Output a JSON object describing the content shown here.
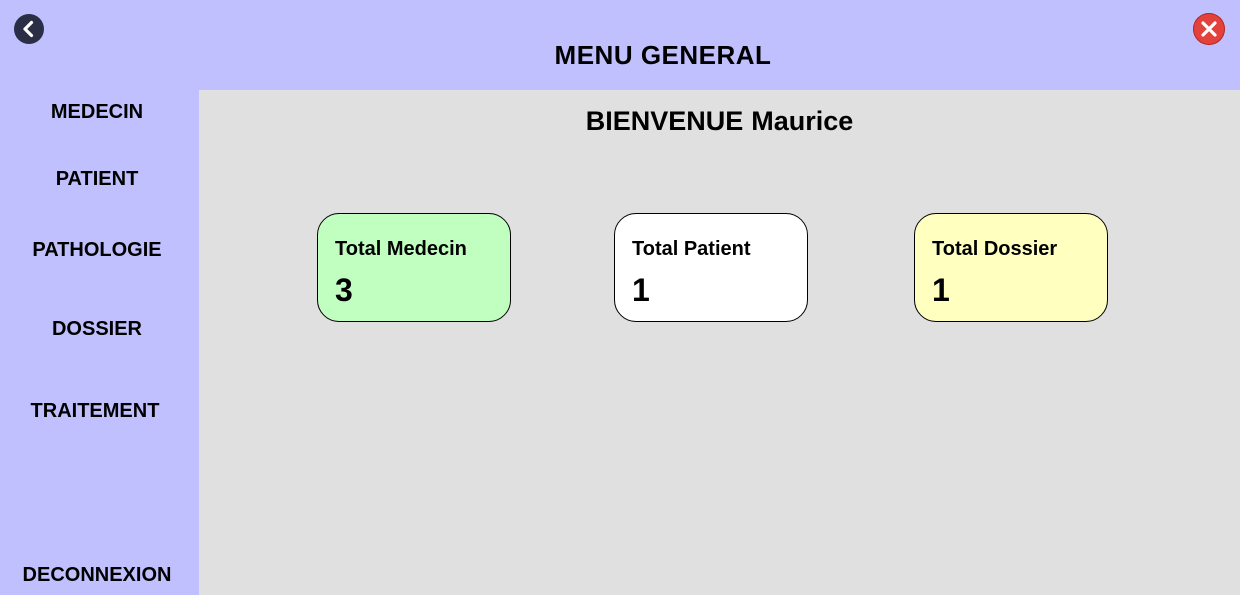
{
  "window": {
    "title": "MENU GENERAL",
    "back_icon": "back-arrow-icon",
    "close_icon": "close-icon"
  },
  "sidebar": {
    "items": [
      {
        "label": "MEDECIN"
      },
      {
        "label": "PATIENT"
      },
      {
        "label": "PATHOLOGIE"
      },
      {
        "label": "DOSSIER"
      },
      {
        "label": "TRAITEMENT"
      }
    ],
    "logout_label": "DECONNEXION"
  },
  "main": {
    "welcome_prefix": "BIENVENUE",
    "user_name": "Maurice",
    "cards": [
      {
        "label": "Total Medecin",
        "value": "3",
        "color": "#c0ffc0"
      },
      {
        "label": "Total Patient",
        "value": "1",
        "color": "#ffffff"
      },
      {
        "label": "Total Dossier",
        "value": "1",
        "color": "#ffffc0"
      }
    ]
  },
  "colors": {
    "sidebar_bg": "#c0c0ff",
    "content_bg": "#e0e0e0",
    "close_red": "#e3423c",
    "back_dark": "#2b2f45"
  }
}
